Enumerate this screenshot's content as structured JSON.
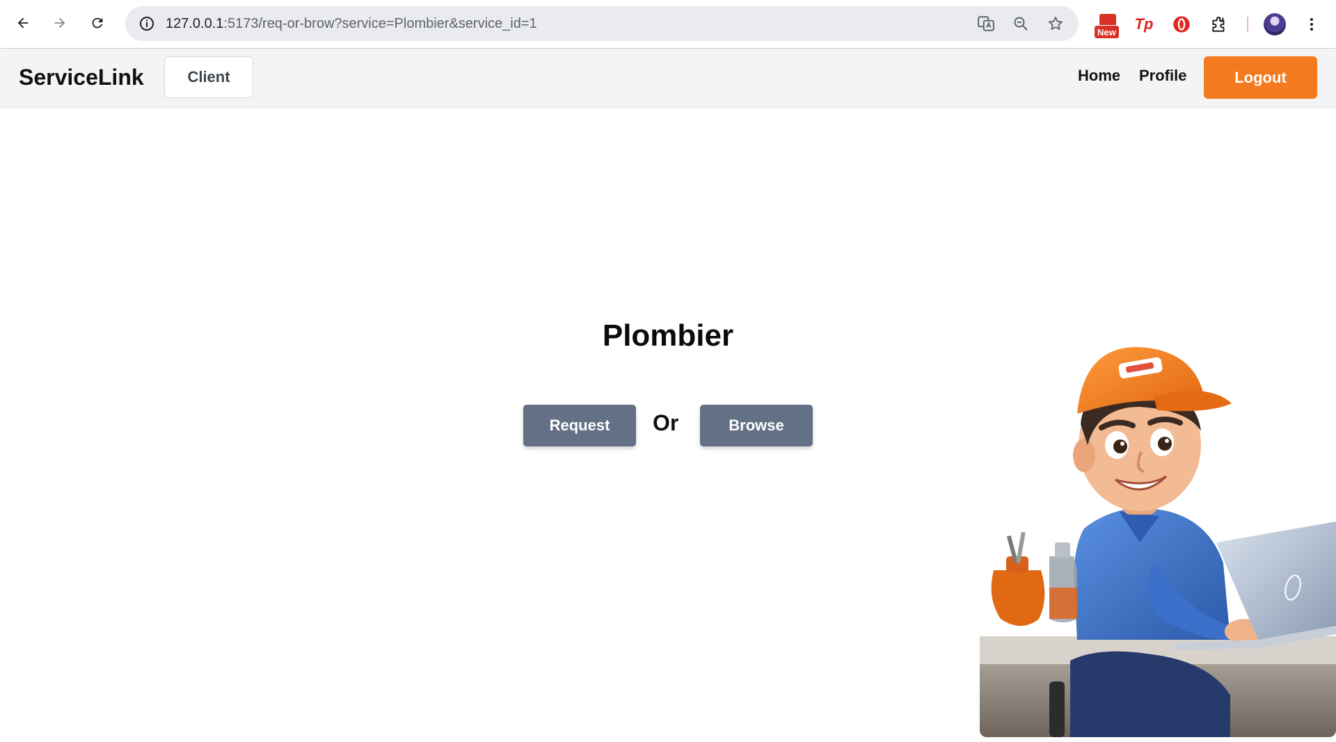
{
  "browser": {
    "url_host": "127.0.0.1",
    "url_rest": ":5173/req-or-brow?service=Plombier&service_id=1",
    "new_badge": "New",
    "ext_tp_label": "Tp"
  },
  "navbar": {
    "brand": "ServiceLink",
    "role_label": "Client",
    "links": [
      {
        "label": "Home"
      },
      {
        "label": "Profile"
      }
    ],
    "logout_label": "Logout",
    "accent_color": "#f37a1f"
  },
  "main": {
    "service_title": "Plombier",
    "request_label": "Request",
    "or_label": "Or",
    "browse_label": "Browse",
    "button_color": "#637086"
  },
  "illustration": {
    "subject": "cartoon plumber at desk with laptop"
  }
}
